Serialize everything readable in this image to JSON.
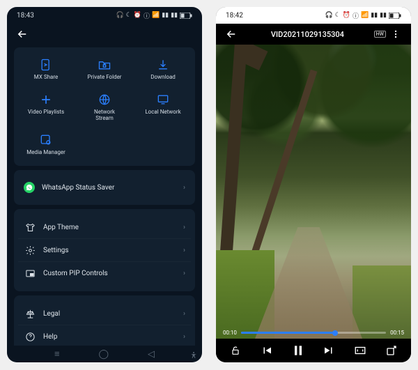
{
  "left": {
    "status_time": "18:43",
    "grid": [
      {
        "name": "mx-share",
        "label": "MX Share"
      },
      {
        "name": "private-folder",
        "label": "Private Folder"
      },
      {
        "name": "download",
        "label": "Download"
      },
      {
        "name": "video-playlists",
        "label": "Video Playlists"
      },
      {
        "name": "network-stream",
        "label": "Network\nStream"
      },
      {
        "name": "local-network",
        "label": "Local Network"
      },
      {
        "name": "media-manager",
        "label": "Media Manager"
      }
    ],
    "rows1": [
      {
        "name": "whatsapp-status-saver",
        "label": "WhatsApp Status Saver",
        "icon": "whatsapp"
      }
    ],
    "rows2": [
      {
        "name": "app-theme",
        "label": "App Theme",
        "icon": "tshirt"
      },
      {
        "name": "settings",
        "label": "Settings",
        "icon": "gear"
      },
      {
        "name": "custom-pip",
        "label": "Custom PIP Controls",
        "icon": "pip"
      }
    ],
    "rows3": [
      {
        "name": "legal",
        "label": "Legal",
        "icon": "scale"
      },
      {
        "name": "help",
        "label": "Help",
        "icon": "help"
      }
    ]
  },
  "right": {
    "status_time": "18:42",
    "video_title": "VID20211029135304",
    "hw_label": "HW",
    "elapsed": "00:10",
    "duration": "00:15",
    "progress_pct": 65
  }
}
